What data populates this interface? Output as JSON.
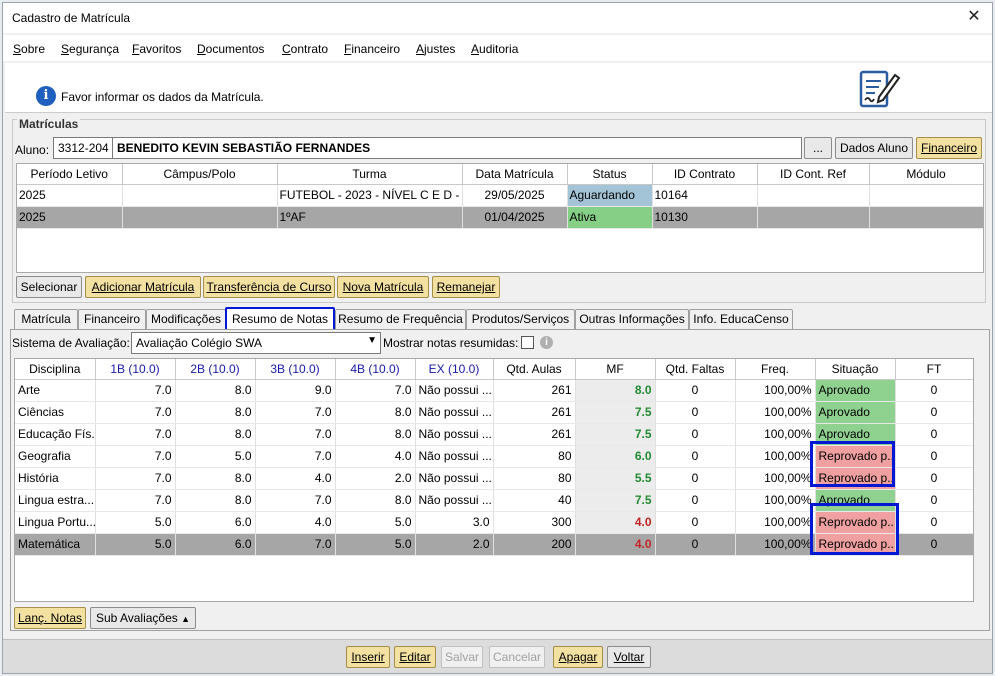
{
  "window": {
    "title": "Cadastro de Matrícula",
    "close_glyph": "✕"
  },
  "menu": [
    "Sobre",
    "Segurança",
    "Favoritos",
    "Documentos",
    "Contrato",
    "Financeiro",
    "Ajustes",
    "Auditoria"
  ],
  "menu_accel": [
    "S",
    "S",
    "F",
    "D",
    "C",
    "F",
    "A",
    "A"
  ],
  "info": {
    "text": "Favor informar os dados da Matrícula.",
    "icon": "info-icon"
  },
  "matriculas": {
    "group_title": "Matrículas",
    "aluno_label": "Aluno:",
    "aluno_code": "3312-204",
    "aluno_name": "BENEDITO KEVIN SEBASTIÃO FERNANDES",
    "ellipsis_label": "...",
    "dados_aluno_label": "Dados Aluno",
    "financeiro_label": "Financeiro",
    "columns": [
      "Período Letivo",
      "Câmpus/Polo",
      "Turma",
      "Data Matrícula",
      "Status",
      "ID Contrato",
      "ID Cont. Ref",
      "Módulo"
    ],
    "rows": [
      {
        "periodo": "2025",
        "campus": "",
        "turma": "FUTEBOL - 2023 - NÍVEL C E D - ...",
        "data": "29/05/2025",
        "status": "Aguardando",
        "id_contrato": "10164",
        "id_ref": "",
        "modulo": ""
      },
      {
        "periodo": "2025",
        "campus": "",
        "turma": "1ºAF",
        "data": "01/04/2025",
        "status": "Ativa",
        "id_contrato": "10130",
        "id_ref": "",
        "modulo": ""
      }
    ],
    "buttons": [
      "Selecionar",
      "Adicionar Matrícula",
      "Transferência de Curso",
      "Nova Matrícula",
      "Remanejar"
    ]
  },
  "tabs": [
    "Matrícula",
    "Financeiro",
    "Modificações",
    "Resumo de Notas",
    "Resumo de Frequência",
    "Produtos/Serviços",
    "Outras Informações",
    "Info. EducaCenso"
  ],
  "active_tab": "Resumo de Notas",
  "notas": {
    "sistema_label": "Sistema de Avaliação:",
    "sistema_value": "Avaliação Colégio SWA",
    "mostrar_label": "Mostrar notas resumidas:",
    "columns": [
      "Disciplina",
      "1B (10.0)",
      "2B (10.0)",
      "3B (10.0)",
      "4B (10.0)",
      "EX (10.0)",
      "Qtd. Aulas",
      "MF",
      "Qtd. Faltas",
      "Freq.",
      "Situação",
      "FT"
    ],
    "rows": [
      {
        "disciplina": "Arte",
        "b1": "7.0",
        "b2": "8.0",
        "b3": "9.0",
        "b4": "7.0",
        "ex": "Não possui ...",
        "aulas": "261",
        "mf": "8.0",
        "mf_status": "green",
        "faltas": "0",
        "freq": "100,00%",
        "situacao": "Aprovado",
        "ft": "0"
      },
      {
        "disciplina": "Ciências",
        "b1": "7.0",
        "b2": "8.0",
        "b3": "7.0",
        "b4": "8.0",
        "ex": "Não possui ...",
        "aulas": "261",
        "mf": "7.5",
        "mf_status": "green",
        "faltas": "0",
        "freq": "100,00%",
        "situacao": "Aprovado",
        "ft": "0"
      },
      {
        "disciplina": "Educação Fís...",
        "b1": "7.0",
        "b2": "8.0",
        "b3": "7.0",
        "b4": "8.0",
        "ex": "Não possui ...",
        "aulas": "261",
        "mf": "7.5",
        "mf_status": "green",
        "faltas": "0",
        "freq": "100,00%",
        "situacao": "Aprovado",
        "ft": "0"
      },
      {
        "disciplina": "Geografia",
        "b1": "7.0",
        "b2": "5.0",
        "b3": "7.0",
        "b4": "4.0",
        "ex": "Não possui ...",
        "aulas": "80",
        "mf": "6.0",
        "mf_status": "green",
        "faltas": "0",
        "freq": "100,00%",
        "situacao": "Reprovado p...",
        "ft": "0"
      },
      {
        "disciplina": "História",
        "b1": "7.0",
        "b2": "8.0",
        "b3": "4.0",
        "b4": "2.0",
        "ex": "Não possui ...",
        "aulas": "80",
        "mf": "5.5",
        "mf_status": "green",
        "faltas": "0",
        "freq": "100,00%",
        "situacao": "Reprovado p...",
        "ft": "0"
      },
      {
        "disciplina": "Lingua estra...",
        "b1": "7.0",
        "b2": "8.0",
        "b3": "7.0",
        "b4": "8.0",
        "ex": "Não possui ...",
        "aulas": "40",
        "mf": "7.5",
        "mf_status": "green",
        "faltas": "0",
        "freq": "100,00%",
        "situacao": "Aprovado",
        "ft": "0"
      },
      {
        "disciplina": "Lingua Portu...",
        "b1": "5.0",
        "b2": "6.0",
        "b3": "4.0",
        "b4": "5.0",
        "ex": "3.0",
        "aulas": "300",
        "mf": "4.0",
        "mf_status": "red",
        "faltas": "0",
        "freq": "100,00%",
        "situacao": "Reprovado p...",
        "ft": "0"
      },
      {
        "disciplina": "Matemática",
        "b1": "5.0",
        "b2": "6.0",
        "b3": "7.0",
        "b4": "5.0",
        "ex": "2.0",
        "aulas": "200",
        "mf": "4.0",
        "mf_status": "red",
        "faltas": "0",
        "freq": "100,00%",
        "situacao": "Reprovado p...",
        "ft": "0"
      }
    ],
    "selected_row": 7,
    "lanc_notas_label": "Lanç. Notas",
    "sub_avaliacoes_label": "Sub Avaliações"
  },
  "footer_buttons": [
    "Inserir",
    "Editar",
    "Salvar",
    "Cancelar",
    "Apagar",
    "Voltar"
  ],
  "colors": {
    "accent_yellow": "#f3e1a2",
    "approved": "#8fd18f",
    "reproved": "#f0a0a0",
    "highlight": "#0018d4",
    "aguardando": "#a3c4d6",
    "ativa": "#86cf86"
  }
}
